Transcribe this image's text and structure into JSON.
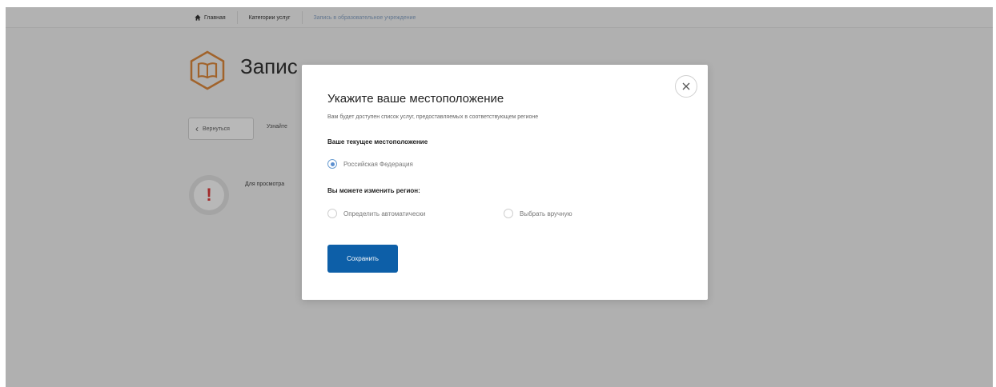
{
  "breadcrumbs": [
    "Главная",
    "Категории услуг",
    "Запись в образовательное учреждение"
  ],
  "page": {
    "title": "Запис",
    "back_label": "Вернуться",
    "side_text": "Узнайте",
    "info_text": "Для просмотра"
  },
  "modal": {
    "title": "Укажите ваше местоположение",
    "subtitle": "Вам будет доступен список услуг, предоставляемых в соответствующем регионе",
    "current_heading": "Ваше текущее местоположение",
    "current_value": "Российская Федерация",
    "change_heading": "Вы можете изменить регион:",
    "option_auto": "Определить автоматически",
    "option_manual": "Выбрать вручную",
    "save_label": "Сохранить"
  },
  "colors": {
    "accent": "#0d5fa8",
    "logo": "#e08a3c",
    "warning": "#e03a3a"
  },
  "icons": [
    "home-icon",
    "book-icon",
    "chevron-left-icon",
    "exclamation-icon",
    "close-icon"
  ]
}
